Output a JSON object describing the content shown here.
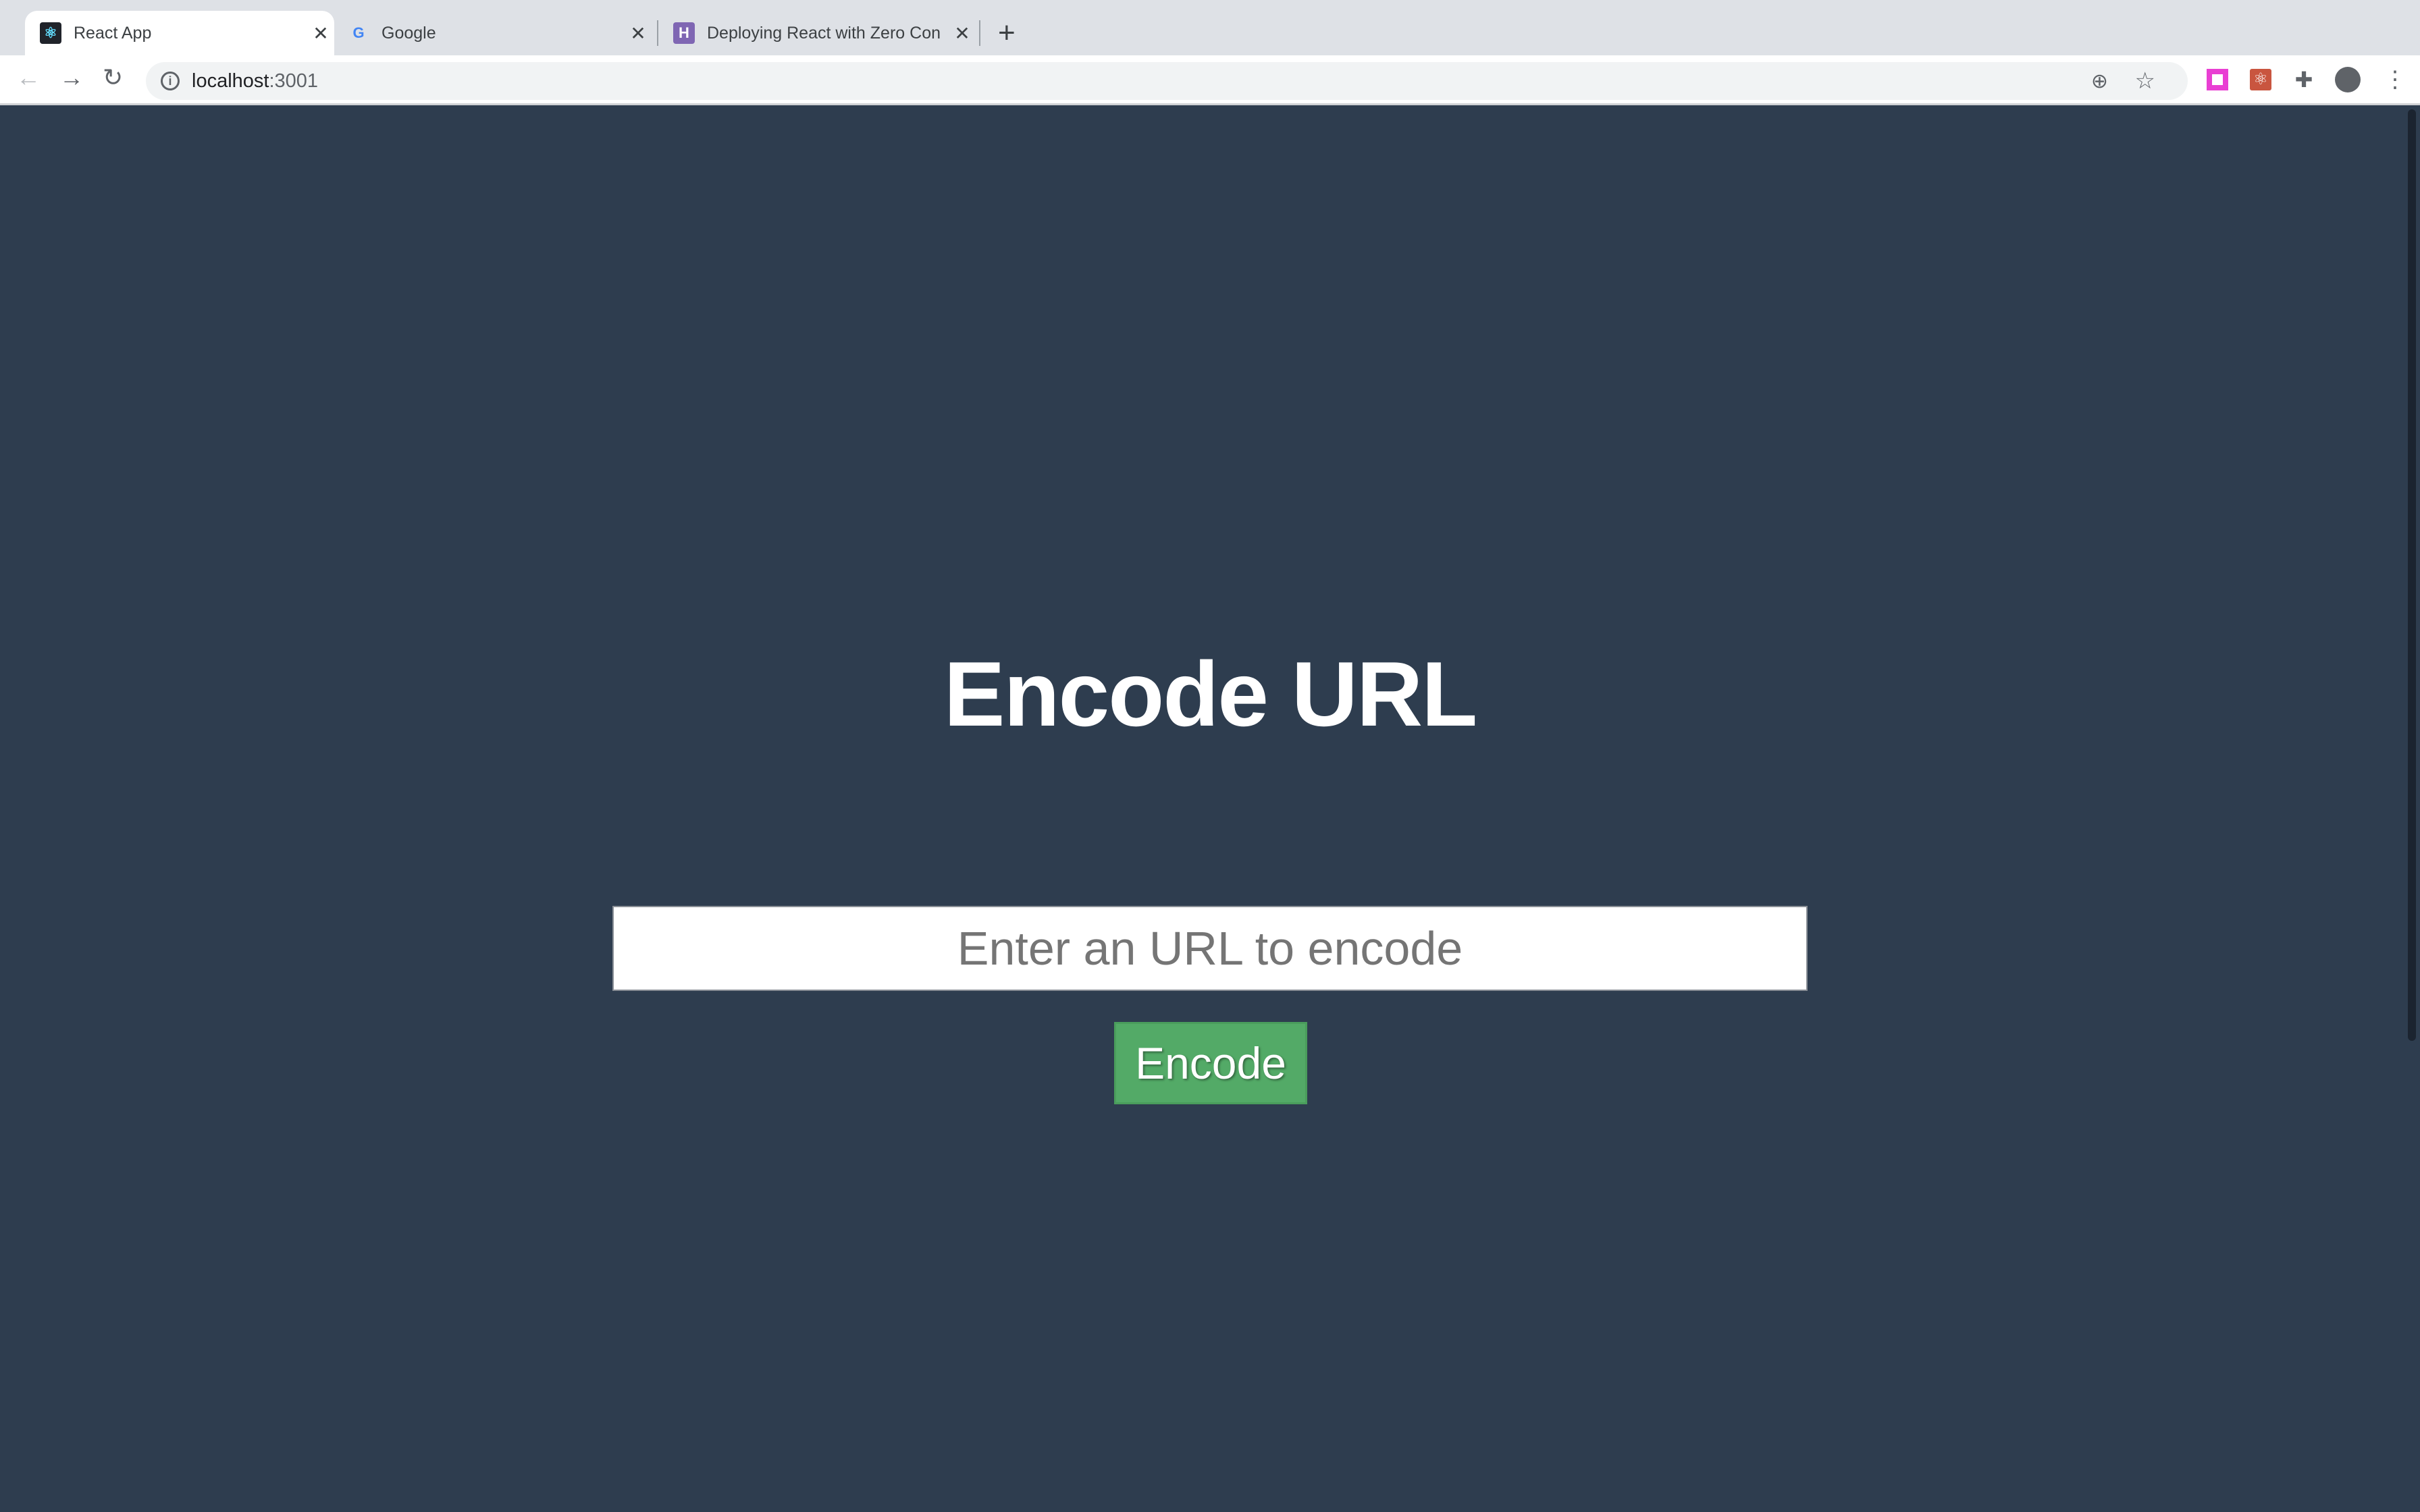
{
  "browser": {
    "tabs": [
      {
        "title": "React App",
        "icon": "react-icon",
        "active": true
      },
      {
        "title": "Google",
        "icon": "google-icon",
        "active": false
      },
      {
        "title": "Deploying React with Zero Con",
        "icon": "heroku-icon",
        "active": false
      }
    ],
    "close_glyph": "✕",
    "new_tab_glyph": "+",
    "url_host": "localhost",
    "url_port": ":3001",
    "extensions": [
      "pink-square-extension-icon",
      "react-devtools-extension-icon",
      "puzzle-extensions-icon",
      "profile-icon",
      "menu-icon"
    ]
  },
  "page": {
    "title": "Encode URL",
    "input_placeholder": "Enter an URL to encode",
    "input_value": "",
    "button_label": "Encode"
  },
  "colors": {
    "background": "#2e3d4f",
    "button": "#53aa67",
    "title": "#ffffff"
  }
}
